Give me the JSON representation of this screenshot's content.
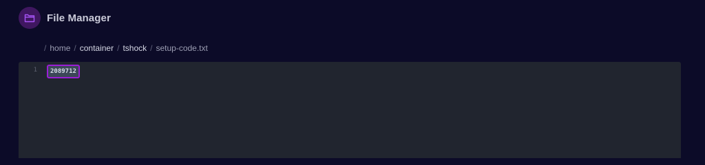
{
  "app": {
    "title": "File Manager",
    "icon": "folder-open-icon"
  },
  "breadcrumb": {
    "separator": "/",
    "items": [
      {
        "label": "home",
        "active": false
      },
      {
        "label": "container",
        "active": true
      },
      {
        "label": "tshock",
        "active": true
      }
    ],
    "current": "setup-code.txt"
  },
  "editor": {
    "lines": [
      {
        "number": "1",
        "text": "2089712",
        "selected": true
      }
    ]
  },
  "colors": {
    "background": "#0c0b28",
    "editor_background": "#21252f",
    "accent": "#9b1ed6",
    "icon_background": "#3f1760"
  }
}
